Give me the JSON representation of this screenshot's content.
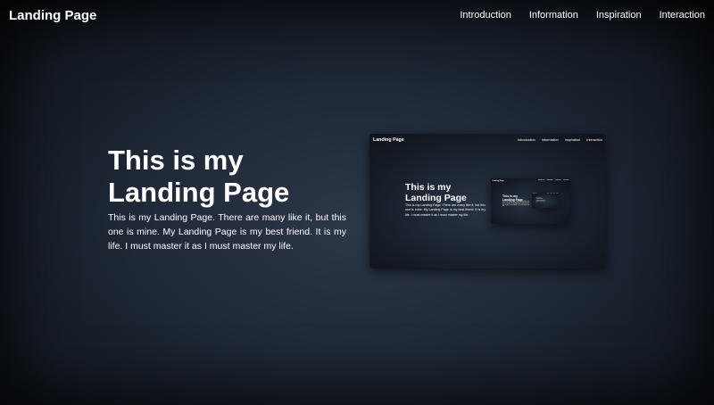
{
  "header": {
    "brand": "Landing Page",
    "nav": [
      "Introduction",
      "Information",
      "Inspiration",
      "Interaction"
    ]
  },
  "hero": {
    "title_line1": "This is my",
    "title_line2": "Landing Page",
    "body": "This is my Landing Page. There are many like it, but this one is mine. My Landing Page is my best friend. It is my life. I must master it as I must master my life."
  },
  "colors": {
    "background_center": "#2c3748",
    "background_edge": "#07090c",
    "text": "#ffffff"
  }
}
